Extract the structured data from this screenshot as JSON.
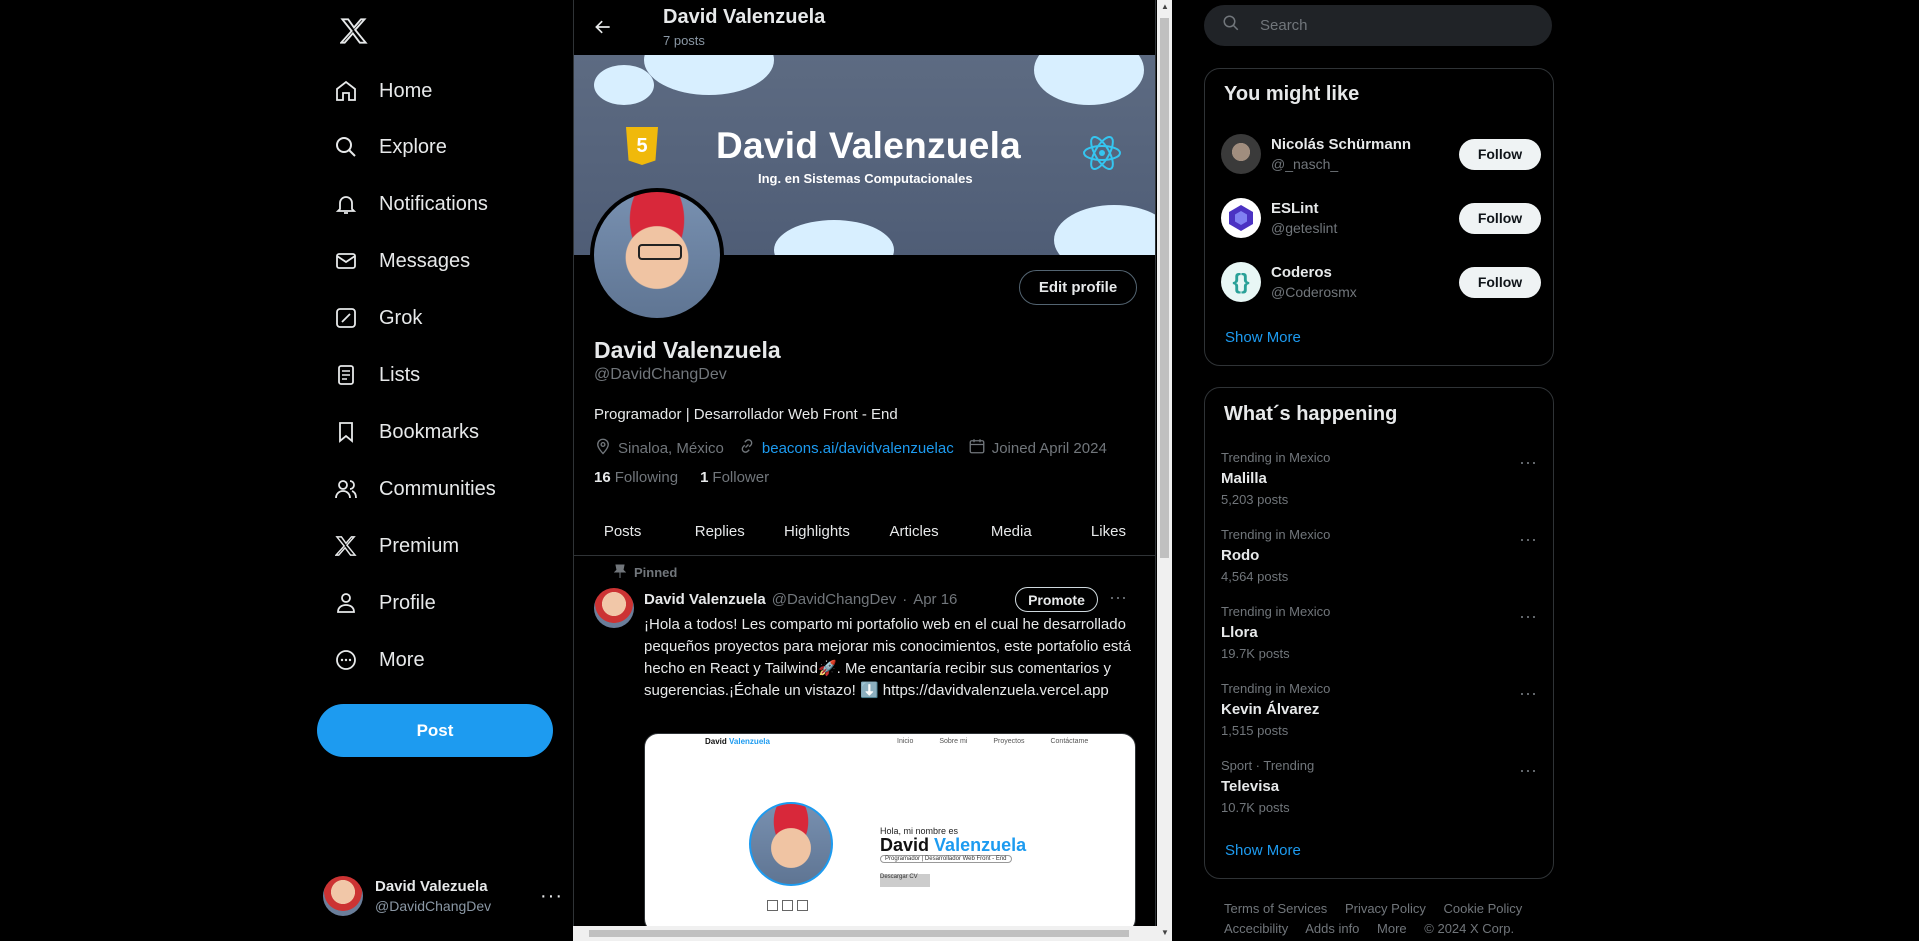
{
  "nav": {
    "items": [
      {
        "label": "Home",
        "icon": "home-icon"
      },
      {
        "label": "Explore",
        "icon": "search-icon"
      },
      {
        "label": "Notifications",
        "icon": "bell-icon"
      },
      {
        "label": "Messages",
        "icon": "envelope-icon"
      },
      {
        "label": "Grok",
        "icon": "grok-icon"
      },
      {
        "label": "Lists",
        "icon": "list-icon"
      },
      {
        "label": "Bookmarks",
        "icon": "bookmark-icon"
      },
      {
        "label": "Communities",
        "icon": "people-icon"
      },
      {
        "label": "Premium",
        "icon": "x-logo-icon"
      },
      {
        "label": "Profile",
        "icon": "person-icon"
      },
      {
        "label": "More",
        "icon": "more-circle-icon"
      }
    ],
    "post_label": "Post",
    "account": {
      "name": "David Valezuela",
      "handle": "@DavidChangDev"
    }
  },
  "header": {
    "title": "David Valenzuela",
    "subtitle": "7 posts"
  },
  "banner": {
    "title": "David Valenzuela",
    "subtitle": "Ing. en Sistemas Computacionales",
    "badge": "JS"
  },
  "profile": {
    "edit_label": "Edit profile",
    "name": "David Valenzuela",
    "handle": "@DavidChangDev",
    "bio": "Programador | Desarrollador Web Front - End",
    "location": "Sinaloa, México",
    "website": "beacons.ai/davidvalenzuelac",
    "joined": "Joined April 2024",
    "following_count": "16",
    "following_label": "Following",
    "followers_count": "1",
    "followers_label": "Follower"
  },
  "tabs": [
    "Posts",
    "Replies",
    "Highlights",
    "Articles",
    "Media",
    "Likes"
  ],
  "tweet": {
    "pinned_label": "Pinned",
    "name": "David Valenzuela",
    "handle": "@DavidChangDev",
    "sep": "·",
    "date": "Apr 16",
    "promote_label": "Promote",
    "text": "¡Hola a todos! Les comparto mi portafolio web en el cual he desarrollado pequeños proyectos para mejorar mis conocimientos, este portafolio está hecho en React y Tailwind🚀. Me encantaría recibir sus comentarios y sugerencias.¡Échale un vistazo! ⬇️ https://davidvalenzuela.vercel.app",
    "preview": {
      "brand_first": "David",
      "brand_last": "Valenzuela",
      "nav": [
        "Inicio",
        "Sobre mi",
        "Proyectos",
        "Contáctame"
      ],
      "greeting": "Hola, mi nombre es",
      "name_first": "David",
      "name_last": "Valenzuela",
      "role": "Programador | Desarrollador Web Front - End",
      "button": "Descargar CV"
    }
  },
  "search": {
    "placeholder": "Search"
  },
  "who_to_follow": {
    "title": "You might like",
    "follow_label": "Follow",
    "accounts": [
      {
        "name": "Nicolás Schürmann",
        "handle": "@_nasch_",
        "color": "#3a3a3a"
      },
      {
        "name": "ESLint",
        "handle": "@geteslint",
        "color": "#4b32c3"
      },
      {
        "name": "Coderos",
        "handle": "@Coderosmx",
        "color": "#2aa198"
      }
    ],
    "show_more": "Show More"
  },
  "trends": {
    "title": "What´s happening",
    "items": [
      {
        "context": "Trending in Mexico",
        "title": "Malilla",
        "count": "5,203 posts"
      },
      {
        "context": "Trending in Mexico",
        "title": "Rodo",
        "count": "4,564 posts"
      },
      {
        "context": "Trending in Mexico",
        "title": "Llora",
        "count": "19.7K posts"
      },
      {
        "context": "Trending in Mexico",
        "title": "Kevin Álvarez",
        "count": "1,515 posts"
      },
      {
        "context": "Sport · Trending",
        "title": "Televisa",
        "count": "10.7K posts"
      }
    ],
    "show_more": "Show More"
  },
  "footer": [
    "Terms of Services",
    "Privacy Policy",
    "Cookie Policy",
    "Accecibility",
    "Adds info",
    "More",
    "© 2024 X Corp."
  ],
  "colors": {
    "accent": "#1d9bf0",
    "background": "#000000",
    "border": "#2f3336"
  }
}
